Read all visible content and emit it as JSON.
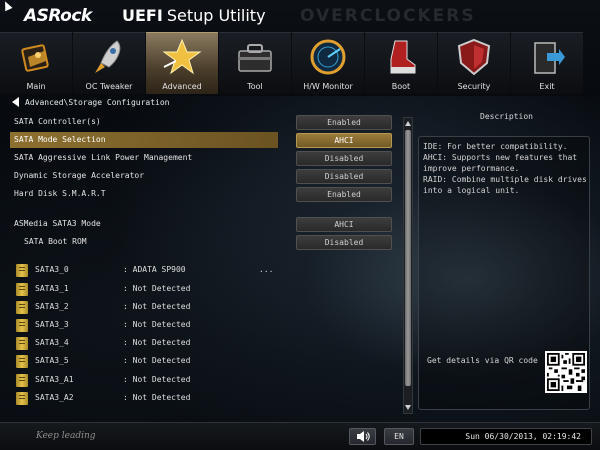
{
  "header": {
    "brand": "ASRock",
    "title_bold": "UEFI",
    "title_rest": "Setup Utility",
    "watermark": "OVERCLOCKERS"
  },
  "tabs": [
    {
      "label": "Main",
      "icon": "main-icon",
      "active": false
    },
    {
      "label": "OC Tweaker",
      "icon": "rocket-icon",
      "active": false
    },
    {
      "label": "Advanced",
      "icon": "star-icon",
      "active": true
    },
    {
      "label": "Tool",
      "icon": "toolbox-icon",
      "active": false
    },
    {
      "label": "H/W Monitor",
      "icon": "radar-icon",
      "active": false
    },
    {
      "label": "Boot",
      "icon": "boot-icon",
      "active": false
    },
    {
      "label": "Security",
      "icon": "shield-icon",
      "active": false
    },
    {
      "label": "Exit",
      "icon": "exit-icon",
      "active": false
    }
  ],
  "breadcrumb": "Advanced\\Storage Configuration",
  "settings": [
    {
      "label": "SATA Controller(s)",
      "value": "Enabled"
    },
    {
      "label": "SATA Mode Selection",
      "value": "AHCI"
    },
    {
      "label": "SATA Aggressive Link Power Management",
      "value": "Disabled"
    },
    {
      "label": "Dynamic Storage Accelerator",
      "value": "Disabled"
    },
    {
      "label": "Hard Disk S.M.A.R.T",
      "value": "Enabled"
    },
    {
      "label": "ASMedia SATA3 Mode",
      "value": "AHCI"
    },
    {
      "label": "SATA Boot ROM",
      "value": "Disabled"
    }
  ],
  "drives": [
    {
      "name": "SATA3_0",
      "value": ": ADATA SP900",
      "extra": "..."
    },
    {
      "name": "SATA3_1",
      "value": ": Not Detected",
      "extra": ""
    },
    {
      "name": "SATA3_2",
      "value": ": Not Detected",
      "extra": ""
    },
    {
      "name": "SATA3_3",
      "value": ": Not Detected",
      "extra": ""
    },
    {
      "name": "SATA3_4",
      "value": ": Not Detected",
      "extra": ""
    },
    {
      "name": "SATA3_5",
      "value": ": Not Detected",
      "extra": ""
    },
    {
      "name": "SATA3_A1",
      "value": ": Not Detected",
      "extra": ""
    },
    {
      "name": "SATA3_A2",
      "value": ": Not Detected",
      "extra": ""
    }
  ],
  "description": {
    "title": "Description",
    "lines": [
      "IDE: For better compatibility.",
      "AHCI: Supports new features that",
      "improve performance.",
      "RAID: Combine multiple disk drives",
      "into a logical unit."
    ],
    "qr_text": "Get details via QR code"
  },
  "footer": {
    "slogan": "Keep leading",
    "language": "EN",
    "datetime": "Sun 06/30/2013, 02:19:42"
  },
  "colors": {
    "accent": "#8d7030",
    "active_tab": "#6b5a40"
  }
}
